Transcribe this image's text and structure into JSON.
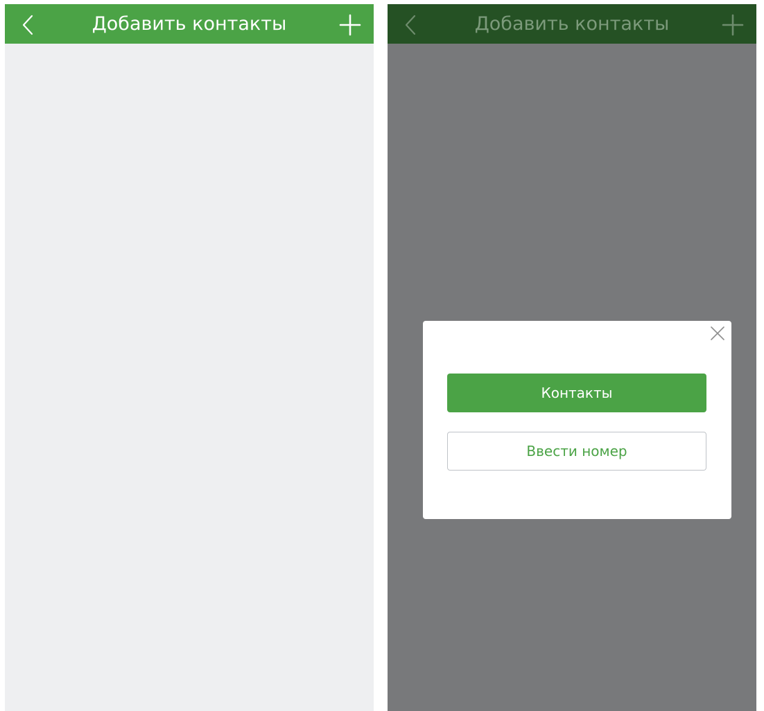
{
  "screens": [
    {
      "header": {
        "title": "Добавить контакты",
        "back_icon": "chevron-left-icon",
        "add_icon": "plus-icon"
      }
    },
    {
      "header": {
        "title": "Добавить контакты",
        "back_icon": "chevron-left-icon",
        "add_icon": "plus-icon"
      },
      "modal": {
        "close_icon": "close-icon",
        "primary_button": "Контакты",
        "secondary_button": "Ввести номер"
      }
    }
  ],
  "colors": {
    "brand_green": "#4ba346",
    "brand_green_dimmed": "#255124",
    "content_background": "#eeeff1",
    "overlay_background": "#78797b",
    "modal_background": "#ffffff",
    "secondary_button_border": "#bfc3c8"
  }
}
